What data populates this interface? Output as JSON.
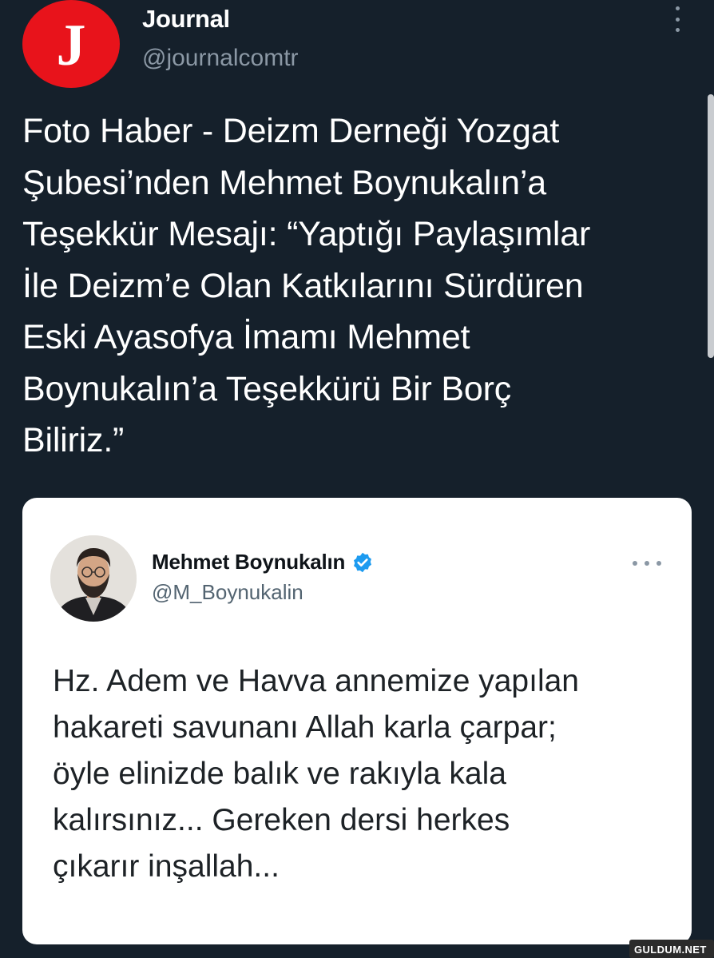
{
  "tweet": {
    "author": {
      "avatar_letter": "J",
      "avatar_color": "#e8131b",
      "display_name": "Journal",
      "handle": "@journalcomtr"
    },
    "more_icon": "more-vertical-icon",
    "text": "Foto Haber - Deizm Derneği Yozgat\nŞubesi’nden Mehmet Boynukalın’a\nTeşekkür Mesajı: “Yaptığı Paylaşımlar\nİle Deizm’e Olan Katkılarını Sürdüren\nEski Ayasofya İmamı Mehmet\nBoynukalın’a Teşekkürü Bir Borç\nBiliriz.”"
  },
  "quoted_screenshot": {
    "author": {
      "display_name": "Mehmet Boynukalın",
      "handle": "@M_Boynukalin",
      "verified": true,
      "verified_icon": "verified-badge-icon"
    },
    "more_icon": "more-horizontal-icon",
    "text": "Hz. Adem ve Havva annemize yapılan\nhakareti savunanı Allah karla çarpar;\nöyle elinizde balık ve rakıyla kala\nkalırsınız... Gereken dersi herkes\nçıkarır inşallah..."
  },
  "watermark": "GULDUM.NET",
  "colors": {
    "background": "#15202b",
    "text_primary": "#ffffff",
    "text_secondary": "#8b98a5",
    "verified_blue": "#1d9bf0"
  }
}
